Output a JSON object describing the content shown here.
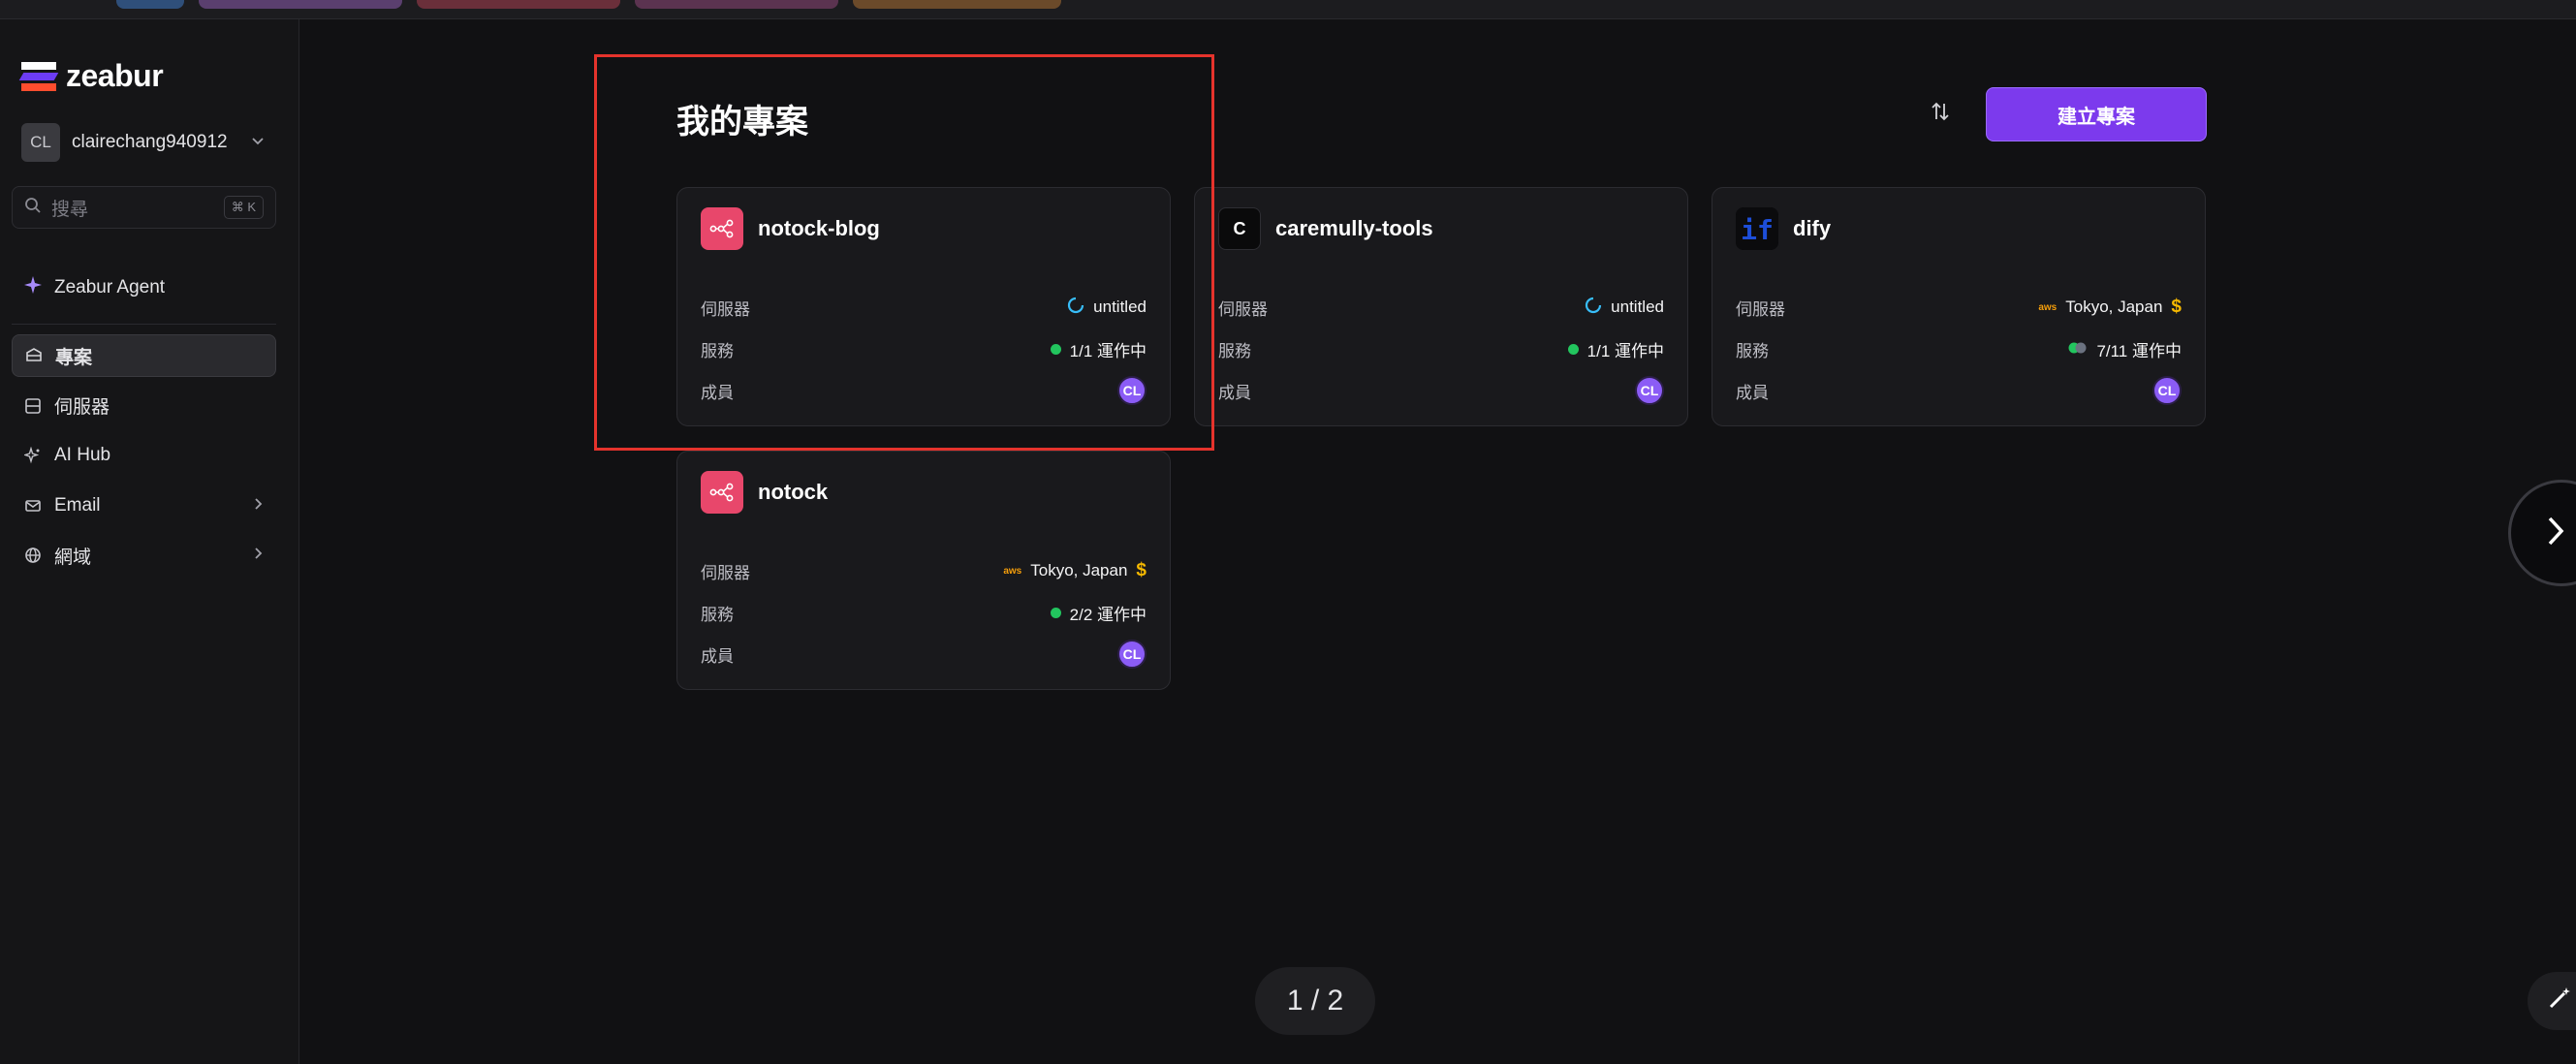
{
  "sidebar": {
    "logo_text": "zeabur",
    "account": {
      "initials": "CL",
      "name": "clairechang940912"
    },
    "search": {
      "placeholder": "搜尋",
      "shortcut": "⌘ K"
    },
    "agent_label": "Zeabur Agent",
    "nav": [
      {
        "label": "專案",
        "icon": "box-icon",
        "active": true
      },
      {
        "label": "伺服器",
        "icon": "server-icon",
        "active": false
      },
      {
        "label": "AI Hub",
        "icon": "sparkle-icon",
        "active": false
      },
      {
        "label": "Email",
        "icon": "mail-icon",
        "active": false
      },
      {
        "label": "網域",
        "icon": "globe-icon",
        "active": false
      }
    ]
  },
  "main": {
    "title": "我的專案",
    "create_button": "建立專案",
    "labels": {
      "server": "伺服器",
      "service": "服務",
      "members": "成員"
    },
    "projects": [
      {
        "name": "notock-blog",
        "icon": "share-icon",
        "server": "untitled",
        "services": "1/1 運作中",
        "member": "CL"
      },
      {
        "name": "caremully-tools",
        "icon_letter": "C",
        "server": "untitled",
        "services": "1/1 運作中",
        "member": "CL"
      },
      {
        "name": "dify",
        "icon_letter": "if",
        "server_provider": "aws",
        "server": "Tokyo, Japan",
        "services": "7/11 運作中",
        "member": "CL"
      },
      {
        "name": "notock",
        "icon": "share-icon",
        "server_provider": "aws",
        "server": "Tokyo, Japan",
        "services": "2/2 運作中",
        "member": "CL"
      }
    ],
    "pager": "1 / 2"
  },
  "colors": {
    "accent": "#7c3aed",
    "running": "#22c55e",
    "highlight": "#e5332c",
    "project_icon": "#e8476b"
  }
}
